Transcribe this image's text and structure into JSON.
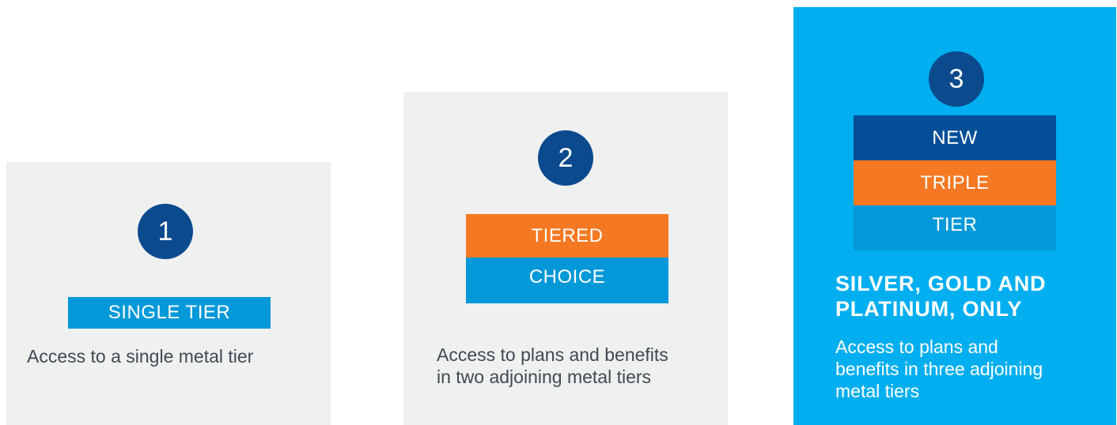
{
  "colors": {
    "panel_gray": "#eff0f0",
    "panel_blue": "#01aeef",
    "navy": "#0c4a8e",
    "dark_blue_band": "#034e97",
    "orange": "#f47922",
    "light_blue_band": "#0398d8",
    "text_gray": "#404a52",
    "white": "#ffffff"
  },
  "tiers": [
    {
      "number": "1",
      "bands": [
        "SINGLE TIER"
      ],
      "description": "Access to a single metal tier"
    },
    {
      "number": "2",
      "bands": [
        "TIERED",
        "CHOICE"
      ],
      "description_lines": [
        "Access to plans and benefits",
        "in two adjoining metal tiers"
      ]
    },
    {
      "number": "3",
      "bands": [
        "NEW",
        "TRIPLE",
        "TIER"
      ],
      "headline_lines": [
        "SILVER, GOLD AND",
        "PLATINUM, ONLY"
      ],
      "description_lines": [
        "Access to plans and",
        "benefits in three adjoining",
        "metal tiers"
      ]
    }
  ]
}
